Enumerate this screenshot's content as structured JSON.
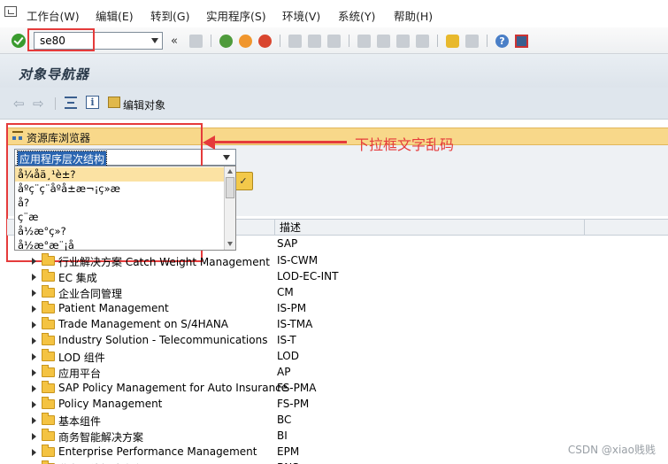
{
  "menu": {
    "items": [
      "工作台(W)",
      "编辑(E)",
      "转到(G)",
      "实用程序(S)",
      "环境(V)",
      "系统(Y)",
      "帮助(H)"
    ]
  },
  "toolbar": {
    "command_value": "se80",
    "double_arrow": "«"
  },
  "title": "对象导航器",
  "app_toolbar": {
    "edit_object_label": "编辑对象"
  },
  "repository": {
    "title": "资源库浏览器",
    "combo_value": "应用程序层次结构",
    "dropdown_items": [
      "å¼åä¸¹è±?",
      "åºç¨ç¨åºå±æ¬¡ç»æ",
      "å?",
      "ç¨æ",
      "å½æ°ç»?",
      "å½æ°æ¨¡å"
    ]
  },
  "annotation": {
    "text": "下拉框文字乱码"
  },
  "tree": {
    "desc_header": "描述",
    "root_desc": "SAP",
    "rows": [
      {
        "name": "行业解决方案 Catch Weight Management",
        "desc": "IS-CWM"
      },
      {
        "name": "EC 集成",
        "desc": "LOD-EC-INT"
      },
      {
        "name": "企业合同管理",
        "desc": "CM"
      },
      {
        "name": "Patient Management",
        "desc": "IS-PM"
      },
      {
        "name": "Trade Management on S/4HANA",
        "desc": "IS-TMA"
      },
      {
        "name": "Industry Solution - Telecommunications",
        "desc": "IS-T"
      },
      {
        "name": "LOD 组件",
        "desc": "LOD"
      },
      {
        "name": "应用平台",
        "desc": "AP"
      },
      {
        "name": "SAP Policy Management for Auto Insurance",
        "desc": "FS-PMA"
      },
      {
        "name": "Policy Management",
        "desc": "FS-PM"
      },
      {
        "name": "基本组件",
        "desc": "BC"
      },
      {
        "name": "商务智能解决方案",
        "desc": "BI"
      },
      {
        "name": "Enterprise Performance Management",
        "desc": "EPM"
      },
      {
        "name": "业务网络解决方案",
        "desc": "BNS"
      }
    ]
  },
  "watermark": "CSDN @xiao贱贱"
}
